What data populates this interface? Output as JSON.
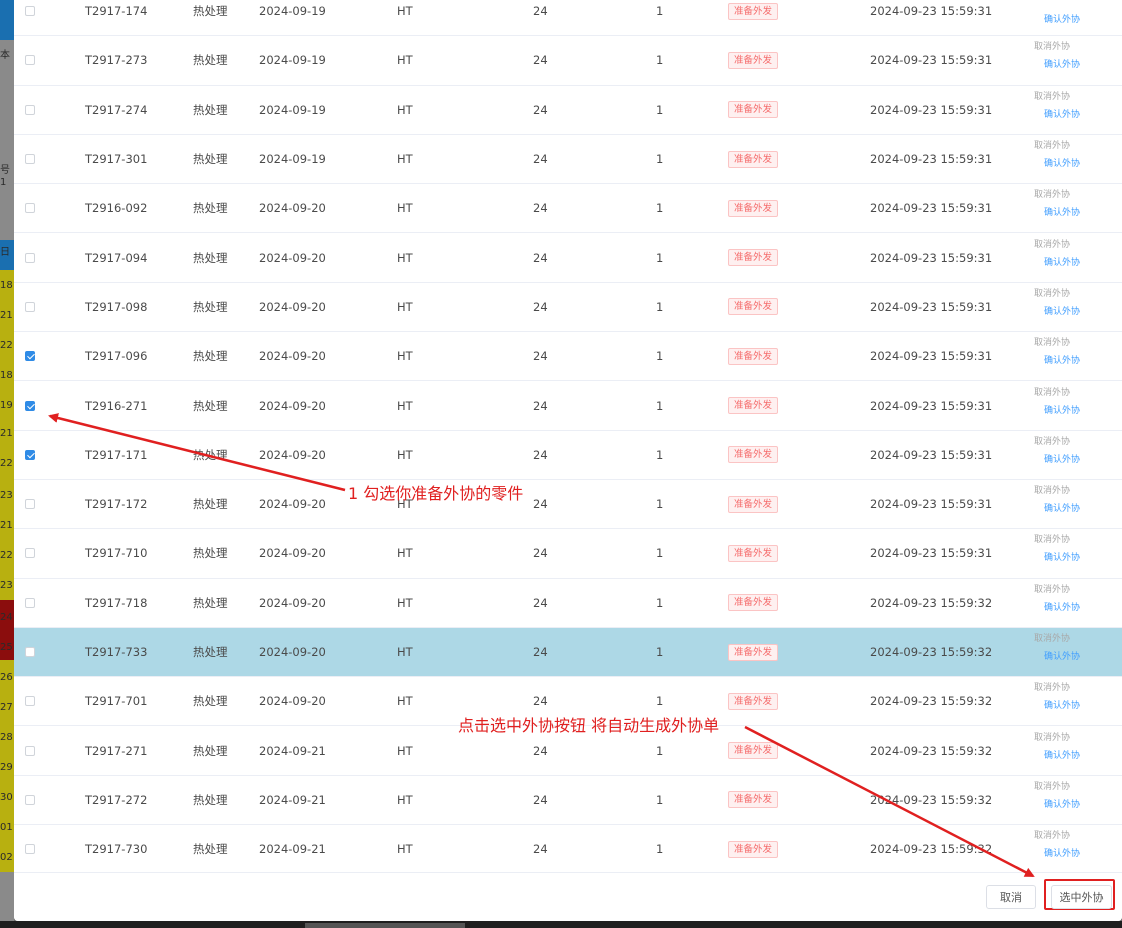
{
  "left_strip": {
    "numbers": [
      "18",
      "21",
      "22",
      "18",
      "19",
      "21",
      "22",
      "23",
      "21",
      "22",
      "23",
      "24",
      "25",
      "26",
      "27",
      "28",
      "29",
      "30",
      "01",
      "02"
    ],
    "labels": [
      "本",
      "号1",
      "日"
    ]
  },
  "rows": [
    {
      "code": "T2917-174",
      "process": "热处理",
      "date": "2024-09-19",
      "material": "HT",
      "qty": "24",
      "num": "1",
      "status": "准备外发",
      "time": "2024-09-23 15:59:31",
      "checked": false
    },
    {
      "code": "T2917-273",
      "process": "热处理",
      "date": "2024-09-19",
      "material": "HT",
      "qty": "24",
      "num": "1",
      "status": "准备外发",
      "time": "2024-09-23 15:59:31",
      "checked": false
    },
    {
      "code": "T2917-274",
      "process": "热处理",
      "date": "2024-09-19",
      "material": "HT",
      "qty": "24",
      "num": "1",
      "status": "准备外发",
      "time": "2024-09-23 15:59:31",
      "checked": false
    },
    {
      "code": "T2917-301",
      "process": "热处理",
      "date": "2024-09-19",
      "material": "HT",
      "qty": "24",
      "num": "1",
      "status": "准备外发",
      "time": "2024-09-23 15:59:31",
      "checked": false
    },
    {
      "code": "T2916-092",
      "process": "热处理",
      "date": "2024-09-20",
      "material": "HT",
      "qty": "24",
      "num": "1",
      "status": "准备外发",
      "time": "2024-09-23 15:59:31",
      "checked": false
    },
    {
      "code": "T2917-094",
      "process": "热处理",
      "date": "2024-09-20",
      "material": "HT",
      "qty": "24",
      "num": "1",
      "status": "准备外发",
      "time": "2024-09-23 15:59:31",
      "checked": false
    },
    {
      "code": "T2917-098",
      "process": "热处理",
      "date": "2024-09-20",
      "material": "HT",
      "qty": "24",
      "num": "1",
      "status": "准备外发",
      "time": "2024-09-23 15:59:31",
      "checked": false
    },
    {
      "code": "T2917-096",
      "process": "热处理",
      "date": "2024-09-20",
      "material": "HT",
      "qty": "24",
      "num": "1",
      "status": "准备外发",
      "time": "2024-09-23 15:59:31",
      "checked": true
    },
    {
      "code": "T2916-271",
      "process": "热处理",
      "date": "2024-09-20",
      "material": "HT",
      "qty": "24",
      "num": "1",
      "status": "准备外发",
      "time": "2024-09-23 15:59:31",
      "checked": true
    },
    {
      "code": "T2917-171",
      "process": "热处理",
      "date": "2024-09-20",
      "material": "HT",
      "qty": "24",
      "num": "1",
      "status": "准备外发",
      "time": "2024-09-23 15:59:31",
      "checked": true
    },
    {
      "code": "T2917-172",
      "process": "热处理",
      "date": "2024-09-20",
      "material": "HT",
      "qty": "24",
      "num": "1",
      "status": "准备外发",
      "time": "2024-09-23 15:59:31",
      "checked": false
    },
    {
      "code": "T2917-710",
      "process": "热处理",
      "date": "2024-09-20",
      "material": "HT",
      "qty": "24",
      "num": "1",
      "status": "准备外发",
      "time": "2024-09-23 15:59:31",
      "checked": false
    },
    {
      "code": "T2917-718",
      "process": "热处理",
      "date": "2024-09-20",
      "material": "HT",
      "qty": "24",
      "num": "1",
      "status": "准备外发",
      "time": "2024-09-23 15:59:32",
      "checked": false
    },
    {
      "code": "T2917-733",
      "process": "热处理",
      "date": "2024-09-20",
      "material": "HT",
      "qty": "24",
      "num": "1",
      "status": "准备外发",
      "time": "2024-09-23 15:59:32",
      "checked": false,
      "highlighted": true
    },
    {
      "code": "T2917-701",
      "process": "热处理",
      "date": "2024-09-20",
      "material": "HT",
      "qty": "24",
      "num": "1",
      "status": "准备外发",
      "time": "2024-09-23 15:59:32",
      "checked": false
    },
    {
      "code": "T2917-271",
      "process": "热处理",
      "date": "2024-09-21",
      "material": "HT",
      "qty": "24",
      "num": "1",
      "status": "准备外发",
      "time": "2024-09-23 15:59:32",
      "checked": false
    },
    {
      "code": "T2917-272",
      "process": "热处理",
      "date": "2024-09-21",
      "material": "HT",
      "qty": "24",
      "num": "1",
      "status": "准备外发",
      "time": "2024-09-23 15:59:32",
      "checked": false
    },
    {
      "code": "T2917-730",
      "process": "热处理",
      "date": "2024-09-21",
      "material": "HT",
      "qty": "24",
      "num": "1",
      "status": "准备外发",
      "time": "2024-09-23 15:59:32",
      "checked": false
    }
  ],
  "row_actions": {
    "cancel_label": "取消外协",
    "confirm_label": "确认外协"
  },
  "footer": {
    "cancel_label": "取消",
    "submit_label": "选中外协"
  },
  "annotations": {
    "step1": "1 勾选你准备外协的零件",
    "step2": "点击选中外协按钮 将自动生成外协单"
  },
  "colors": {
    "annotation": "#e02020",
    "checked": "#2f8be6",
    "highlight_row": "#add8e6",
    "tag_text": "#f56c6c",
    "link": "#409eff"
  }
}
